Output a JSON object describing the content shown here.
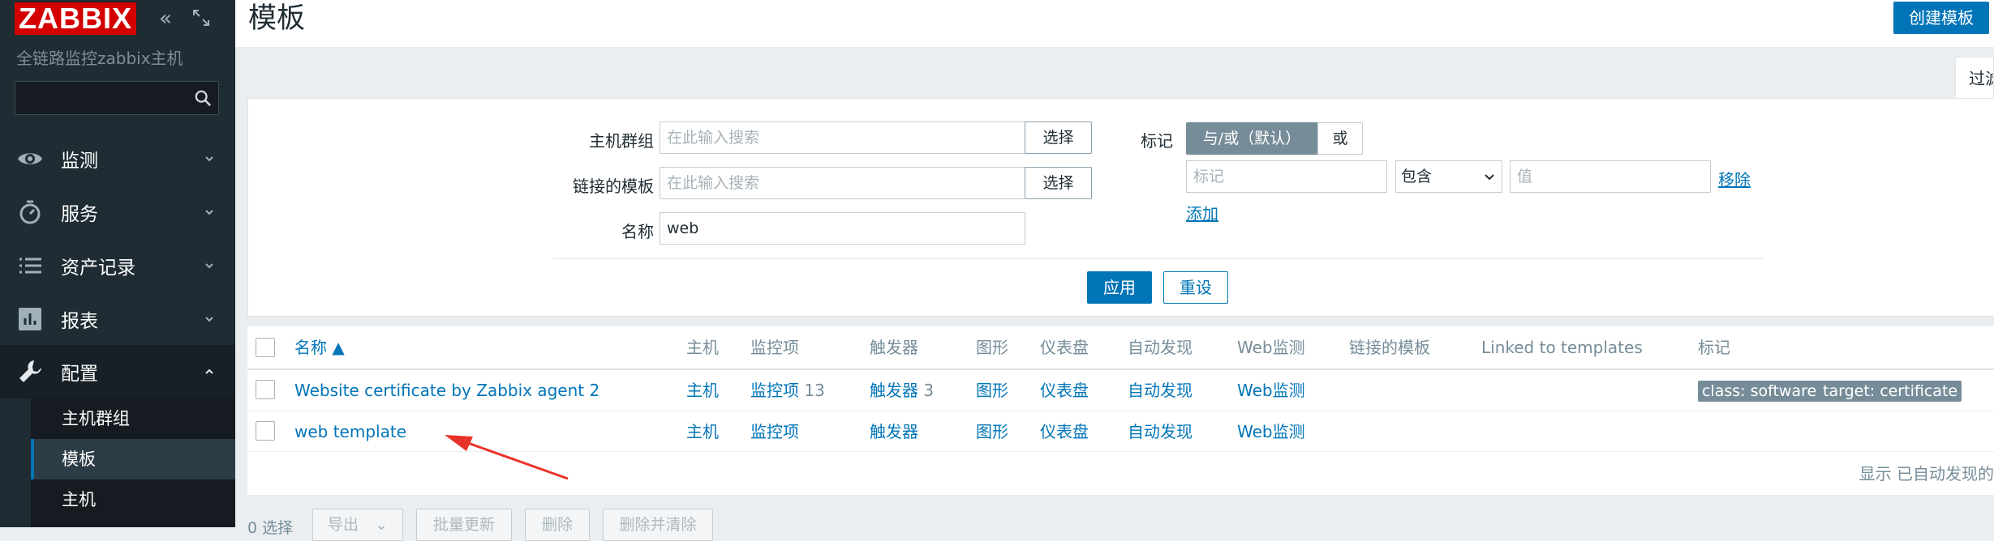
{
  "sidebar": {
    "logo": "ZABBIX",
    "hostname": "全链路监控zabbix主机",
    "menu": [
      {
        "label": "监测",
        "icon": "eye-icon"
      },
      {
        "label": "服务",
        "icon": "stopwatch-icon"
      },
      {
        "label": "资产记录",
        "icon": "list-icon"
      },
      {
        "label": "报表",
        "icon": "bar-chart-icon"
      },
      {
        "label": "配置",
        "icon": "wrench-icon"
      }
    ],
    "submenu": [
      "主机群组",
      "模板",
      "主机"
    ]
  },
  "header": {
    "title": "模板",
    "create_button": "创建模板"
  },
  "filter": {
    "tab": "过滤器",
    "host_groups_label": "主机群组",
    "host_groups_placeholder": "在此输入搜索",
    "linked_templates_label": "链接的模板",
    "linked_templates_placeholder": "在此输入搜索",
    "select_label": "选择",
    "name_label": "名称",
    "name_value": "web",
    "tags_label": "标记",
    "and_or": "与/或（默认）",
    "or": "或",
    "tag_placeholder": "标记",
    "operator": "包含",
    "value_placeholder": "值",
    "remove": "移除",
    "add": "添加",
    "apply": "应用",
    "reset": "重设"
  },
  "table": {
    "columns": [
      "名称 ▲",
      "主机",
      "监控项",
      "触发器",
      "图形",
      "仪表盘",
      "自动发现",
      "Web监测",
      "链接的模板",
      "Linked to templates",
      "标记"
    ],
    "rows": [
      {
        "name": "Website certificate by Zabbix agent 2",
        "hosts": "主机",
        "items": "监控项",
        "items_count": "13",
        "triggers": "触发器",
        "triggers_count": "3",
        "graphs": "图形",
        "dashboards": "仪表盘",
        "discovery": "自动发现",
        "web": "Web监测",
        "tags": [
          "class: software",
          "target: certificate"
        ]
      },
      {
        "name": "web template",
        "hosts": "主机",
        "items": "监控项",
        "triggers": "触发器",
        "graphs": "图形",
        "dashboards": "仪表盘",
        "discovery": "自动发现",
        "web": "Web监测"
      }
    ],
    "footer": "显示 已自动发现的"
  },
  "actions": {
    "selected": "0 选择",
    "export": "导出",
    "mass_update": "批量更新",
    "delete": "删除",
    "delete_clear": "删除并清除"
  },
  "colors": {
    "sidebar_bg": "#1f2c33",
    "accent": "#0275b8",
    "logo_red": "#d40000",
    "tag_bg": "#768d99",
    "annotation": "#e8332a"
  }
}
